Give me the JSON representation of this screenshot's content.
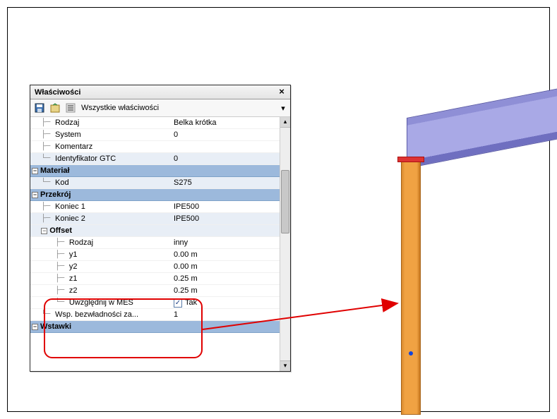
{
  "panel": {
    "title": "Właściwości",
    "close": "×",
    "toolbar_label": "Wszystkie właściwości"
  },
  "rows": {
    "rodzaj_label": "Rodzaj",
    "rodzaj_val": "Belka krótka",
    "system_label": "System",
    "system_val": "0",
    "komentarz_label": "Komentarz",
    "komentarz_val": "",
    "idgtc_label": "Identyfikator GTC",
    "idgtc_val": "0",
    "material_label": "Materiał",
    "kod_label": "Kod",
    "kod_val": "S275",
    "przekroj_label": "Przekrój",
    "koniec1_label": "Koniec 1",
    "koniec1_val": "IPE500",
    "koniec2_label": "Koniec 2",
    "koniec2_val": "IPE500",
    "offset_label": "Offset",
    "off_rodzaj_label": "Rodzaj",
    "off_rodzaj_val": "inny",
    "y1_label": "y1",
    "y1_val": "0.00 m",
    "y2_label": "y2",
    "y2_val": "0.00 m",
    "z1_label": "z1",
    "z1_val": "0.25 m",
    "z2_label": "z2",
    "z2_val": "0.25 m",
    "mes_label": "Uwzględnij w MES",
    "mes_val": "Tak",
    "wsp_label": "Wsp. bezwładności za...",
    "wsp_val": "1",
    "wstawki_label": "Wstawki"
  }
}
